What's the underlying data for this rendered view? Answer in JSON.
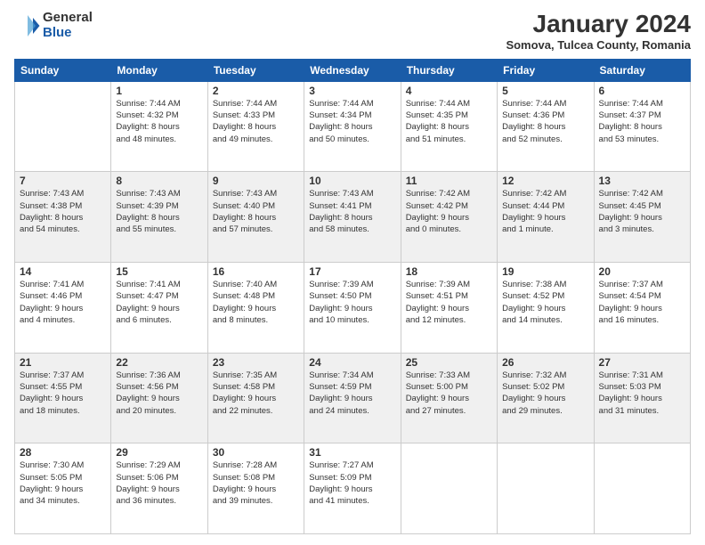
{
  "logo": {
    "general": "General",
    "blue": "Blue"
  },
  "header": {
    "month_year": "January 2024",
    "location": "Somova, Tulcea County, Romania"
  },
  "days_of_week": [
    "Sunday",
    "Monday",
    "Tuesday",
    "Wednesday",
    "Thursday",
    "Friday",
    "Saturday"
  ],
  "weeks": [
    [
      {
        "day": "",
        "info": ""
      },
      {
        "day": "1",
        "info": "Sunrise: 7:44 AM\nSunset: 4:32 PM\nDaylight: 8 hours\nand 48 minutes."
      },
      {
        "day": "2",
        "info": "Sunrise: 7:44 AM\nSunset: 4:33 PM\nDaylight: 8 hours\nand 49 minutes."
      },
      {
        "day": "3",
        "info": "Sunrise: 7:44 AM\nSunset: 4:34 PM\nDaylight: 8 hours\nand 50 minutes."
      },
      {
        "day": "4",
        "info": "Sunrise: 7:44 AM\nSunset: 4:35 PM\nDaylight: 8 hours\nand 51 minutes."
      },
      {
        "day": "5",
        "info": "Sunrise: 7:44 AM\nSunset: 4:36 PM\nDaylight: 8 hours\nand 52 minutes."
      },
      {
        "day": "6",
        "info": "Sunrise: 7:44 AM\nSunset: 4:37 PM\nDaylight: 8 hours\nand 53 minutes."
      }
    ],
    [
      {
        "day": "7",
        "info": "Sunrise: 7:43 AM\nSunset: 4:38 PM\nDaylight: 8 hours\nand 54 minutes."
      },
      {
        "day": "8",
        "info": "Sunrise: 7:43 AM\nSunset: 4:39 PM\nDaylight: 8 hours\nand 55 minutes."
      },
      {
        "day": "9",
        "info": "Sunrise: 7:43 AM\nSunset: 4:40 PM\nDaylight: 8 hours\nand 57 minutes."
      },
      {
        "day": "10",
        "info": "Sunrise: 7:43 AM\nSunset: 4:41 PM\nDaylight: 8 hours\nand 58 minutes."
      },
      {
        "day": "11",
        "info": "Sunrise: 7:42 AM\nSunset: 4:42 PM\nDaylight: 9 hours\nand 0 minutes."
      },
      {
        "day": "12",
        "info": "Sunrise: 7:42 AM\nSunset: 4:44 PM\nDaylight: 9 hours\nand 1 minute."
      },
      {
        "day": "13",
        "info": "Sunrise: 7:42 AM\nSunset: 4:45 PM\nDaylight: 9 hours\nand 3 minutes."
      }
    ],
    [
      {
        "day": "14",
        "info": "Sunrise: 7:41 AM\nSunset: 4:46 PM\nDaylight: 9 hours\nand 4 minutes."
      },
      {
        "day": "15",
        "info": "Sunrise: 7:41 AM\nSunset: 4:47 PM\nDaylight: 9 hours\nand 6 minutes."
      },
      {
        "day": "16",
        "info": "Sunrise: 7:40 AM\nSunset: 4:48 PM\nDaylight: 9 hours\nand 8 minutes."
      },
      {
        "day": "17",
        "info": "Sunrise: 7:39 AM\nSunset: 4:50 PM\nDaylight: 9 hours\nand 10 minutes."
      },
      {
        "day": "18",
        "info": "Sunrise: 7:39 AM\nSunset: 4:51 PM\nDaylight: 9 hours\nand 12 minutes."
      },
      {
        "day": "19",
        "info": "Sunrise: 7:38 AM\nSunset: 4:52 PM\nDaylight: 9 hours\nand 14 minutes."
      },
      {
        "day": "20",
        "info": "Sunrise: 7:37 AM\nSunset: 4:54 PM\nDaylight: 9 hours\nand 16 minutes."
      }
    ],
    [
      {
        "day": "21",
        "info": "Sunrise: 7:37 AM\nSunset: 4:55 PM\nDaylight: 9 hours\nand 18 minutes."
      },
      {
        "day": "22",
        "info": "Sunrise: 7:36 AM\nSunset: 4:56 PM\nDaylight: 9 hours\nand 20 minutes."
      },
      {
        "day": "23",
        "info": "Sunrise: 7:35 AM\nSunset: 4:58 PM\nDaylight: 9 hours\nand 22 minutes."
      },
      {
        "day": "24",
        "info": "Sunrise: 7:34 AM\nSunset: 4:59 PM\nDaylight: 9 hours\nand 24 minutes."
      },
      {
        "day": "25",
        "info": "Sunrise: 7:33 AM\nSunset: 5:00 PM\nDaylight: 9 hours\nand 27 minutes."
      },
      {
        "day": "26",
        "info": "Sunrise: 7:32 AM\nSunset: 5:02 PM\nDaylight: 9 hours\nand 29 minutes."
      },
      {
        "day": "27",
        "info": "Sunrise: 7:31 AM\nSunset: 5:03 PM\nDaylight: 9 hours\nand 31 minutes."
      }
    ],
    [
      {
        "day": "28",
        "info": "Sunrise: 7:30 AM\nSunset: 5:05 PM\nDaylight: 9 hours\nand 34 minutes."
      },
      {
        "day": "29",
        "info": "Sunrise: 7:29 AM\nSunset: 5:06 PM\nDaylight: 9 hours\nand 36 minutes."
      },
      {
        "day": "30",
        "info": "Sunrise: 7:28 AM\nSunset: 5:08 PM\nDaylight: 9 hours\nand 39 minutes."
      },
      {
        "day": "31",
        "info": "Sunrise: 7:27 AM\nSunset: 5:09 PM\nDaylight: 9 hours\nand 41 minutes."
      },
      {
        "day": "",
        "info": ""
      },
      {
        "day": "",
        "info": ""
      },
      {
        "day": "",
        "info": ""
      }
    ]
  ]
}
